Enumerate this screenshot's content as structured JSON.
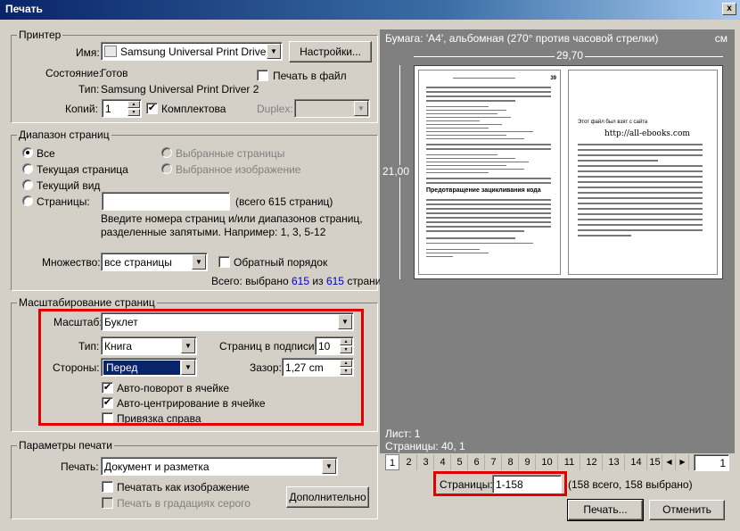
{
  "window": {
    "title": "Печать",
    "close_glyph": "x"
  },
  "printer": {
    "legend": "Принтер",
    "name_label": "Имя:",
    "name_value": "Samsung Universal Print Driver 2",
    "settings_button": "Настройки...",
    "status_label": "Состояние:",
    "status_value": "Готов",
    "print_to_file": "Печать в файл",
    "type_label": "Тип:",
    "type_value": "Samsung Universal Print Driver 2",
    "copies_label": "Копий:",
    "copies_value": "1",
    "collate_label": "Комплектова",
    "duplex_label": "Duplex:",
    "duplex_value": ""
  },
  "range": {
    "legend": "Диапазон страниц",
    "all": "Все",
    "current_page": "Текущая страница",
    "current_view": "Текущий вид",
    "pages": "Страницы:",
    "pages_value": "",
    "pages_total": "(всего 615 страниц)",
    "selected_pages": "Выбранные страницы",
    "selected_image": "Выбранное изображение",
    "hint_line1": "Введите номера страниц и/или диапазонов страниц,",
    "hint_line2": "разделенные запятыми. Например: 1, 3, 5-12",
    "set_label": "Множество:",
    "set_value": "все страницы",
    "reverse": "Обратный порядок",
    "summary_prefix": "Всего: выбрано",
    "summary_selected": "615",
    "summary_mid": "из",
    "summary_total": "615",
    "summary_suffix": "страниц"
  },
  "scaling": {
    "legend": "Масштабирование страниц",
    "scale_label": "Масштаб:",
    "scale_value": "Буклет",
    "type_label": "Тип:",
    "type_value": "Книга",
    "sig_label": "Страниц в подписи:",
    "sig_value": "10",
    "sides_label": "Стороны:",
    "sides_value": "Перед",
    "gap_label": "Зазор:",
    "gap_value": "1,27 cm",
    "auto_rotate": "Авто-поворот в ячейке",
    "auto_center": "Авто-центрирование в ячейке",
    "bind_right": "Привязка справа"
  },
  "params": {
    "legend": "Параметры печати",
    "print_label": "Печать:",
    "print_value": "Документ и разметка",
    "as_image": "Печатать как изображение",
    "grayscale": "Печать в градациях серого",
    "advanced_button": "Дополнительно"
  },
  "preview": {
    "header": "Бумага: 'A4', альбомная (270° против часовой стрелки)",
    "unit": "см",
    "width_dim": "29,70",
    "height_dim": "21,00",
    "right_page_text": "Этот файл был взят с сайта",
    "right_page_url": "http://all-ebooks.com",
    "left_page_heading": "Предотвращение зацикливания кода",
    "left_page_number": "39",
    "sheet_label": "Лист: 1",
    "pages_label": "Страницы: 40, 1"
  },
  "page_tabs": [
    "1",
    "2",
    "3",
    "4",
    "5",
    "6",
    "7",
    "8",
    "9",
    "10",
    "11",
    "12",
    "13",
    "14",
    "15"
  ],
  "page_input": "1",
  "pages_field": {
    "label": "Страницы:",
    "value": "1-158",
    "summary": "(158 всего, 158 выбрано)"
  },
  "buttons": {
    "print": "Печать...",
    "cancel": "Отменить"
  },
  "colors": {
    "highlight": "#e00000",
    "title_bar": "#0a246a",
    "accent_blue": "#0000c0",
    "selection": "#0a246a"
  }
}
